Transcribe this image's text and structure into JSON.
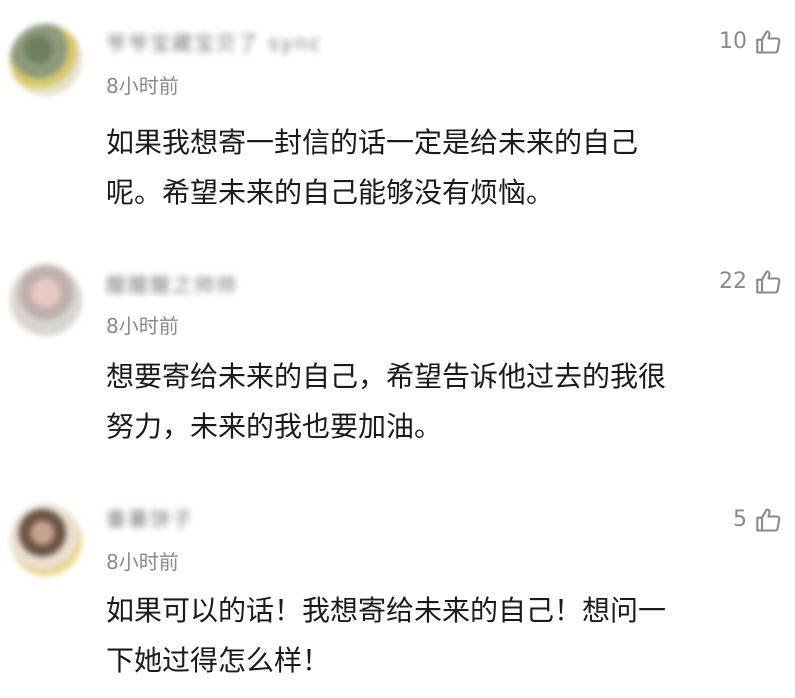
{
  "comments": [
    {
      "username": "爷爷宝藏宝贝了 sync",
      "time": "8小时前",
      "likes": "10",
      "text": "如果我想寄一封信的话一定是给未来的自己\n呢。希望未来的自己能够没有烦恼。"
    },
    {
      "username": "醒醒醒之帅帅",
      "time": "8小时前",
      "likes": "22",
      "text": "想要寄给未来的自己，希望告诉他过去的我很\n努力，未来的我也要加油。"
    },
    {
      "username": "番薯饼子",
      "time": "8小时前",
      "likes": "5",
      "text": "如果可以的话！我想寄给未来的自己！想问一\n下她过得怎么样！"
    }
  ],
  "icons": {
    "like": "thumbs-up-outline-icon"
  }
}
